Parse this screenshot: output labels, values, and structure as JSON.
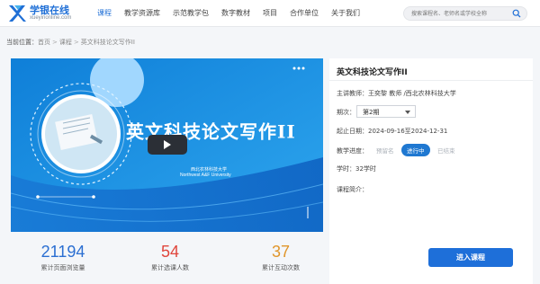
{
  "header": {
    "brand_name": "学银在线",
    "brand_domain": "xueyinonline.com",
    "nav": [
      "课程",
      "教学资源库",
      "示范教学包",
      "数字教材",
      "项目",
      "合作单位",
      "关于我们"
    ],
    "active_nav_index": 0,
    "search_placeholder": "搜索课程名、老师名或学校全称",
    "search_icon": "search-icon",
    "accent_color": "#1f6fd6"
  },
  "breadcrumb": {
    "prefix": "当前位置：",
    "items": [
      "首页",
      "课程",
      "英文科技论文写作II"
    ],
    "separator": ">"
  },
  "banner": {
    "title": "英文科技论文写作II",
    "university_cn": "西北农林科技大学",
    "university_en": "Northwest  A&F  University",
    "more_icon": "more-dots-icon",
    "play_icon": "play-icon"
  },
  "stats": [
    {
      "value": "21194",
      "label": "累计页面浏览量",
      "color": "#2b6fd2"
    },
    {
      "value": "54",
      "label": "累计选课人数",
      "color": "#e0453c"
    },
    {
      "value": "37",
      "label": "累计互动次数",
      "color": "#e0962b"
    }
  ],
  "course": {
    "title": "英文科技论文写作II",
    "teacher": "主讲教师：王奕黎 教师 /西北农林科技大学",
    "term_label": "期次：",
    "term_value": "第2期",
    "dates": "起止日期：2024-09-16至2024-12-31",
    "progress_label": "教学进度：",
    "progress_options": [
      "预留名",
      "进行中",
      "已结束"
    ],
    "progress_active_index": 1,
    "hours": "学时：32学时",
    "intro_label": "课程简介：",
    "enter_label": "进入课程"
  }
}
